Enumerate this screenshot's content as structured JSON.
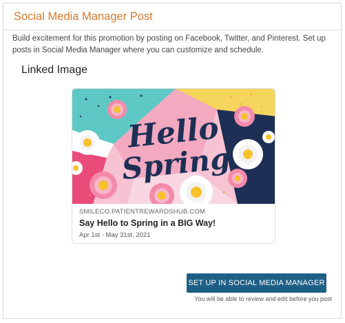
{
  "panel": {
    "title": "Social Media Manager Post",
    "description": "Build excitement for this promotion by posting on Facebook, Twitter, and Pinterest. Set up posts in Social Media Manager where you can customize and schedule."
  },
  "linked_image": {
    "heading": "Linked Image",
    "image_text_line1": "Hello",
    "image_text_line2": "Spring",
    "domain": "SMILECO.PATIENTREWARDSHUB.COM",
    "title": "Say Hello to Spring in a BIG Way!",
    "dates": "Apr 1st - May 31st, 2021"
  },
  "cta": {
    "button_label": "SET UP IN SOCIAL MEDIA MANAGER",
    "note": "You will be able to review and edit before you post"
  },
  "colors": {
    "title_orange": "#d7792f",
    "button_blue": "#1e5f86",
    "teal": "#5ec8c4",
    "pink": "#f4b6c9",
    "navy": "#1d2f55",
    "yellow": "#f6d55c"
  }
}
